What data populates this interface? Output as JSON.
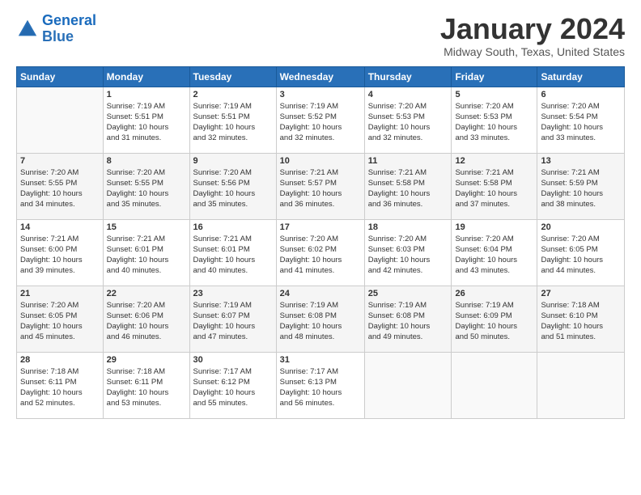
{
  "header": {
    "logo_line1": "General",
    "logo_line2": "Blue",
    "title": "January 2024",
    "subtitle": "Midway South, Texas, United States"
  },
  "days_of_week": [
    "Sunday",
    "Monday",
    "Tuesday",
    "Wednesday",
    "Thursday",
    "Friday",
    "Saturday"
  ],
  "weeks": [
    [
      {
        "day": "",
        "info": ""
      },
      {
        "day": "1",
        "info": "Sunrise: 7:19 AM\nSunset: 5:51 PM\nDaylight: 10 hours\nand 31 minutes."
      },
      {
        "day": "2",
        "info": "Sunrise: 7:19 AM\nSunset: 5:51 PM\nDaylight: 10 hours\nand 32 minutes."
      },
      {
        "day": "3",
        "info": "Sunrise: 7:19 AM\nSunset: 5:52 PM\nDaylight: 10 hours\nand 32 minutes."
      },
      {
        "day": "4",
        "info": "Sunrise: 7:20 AM\nSunset: 5:53 PM\nDaylight: 10 hours\nand 32 minutes."
      },
      {
        "day": "5",
        "info": "Sunrise: 7:20 AM\nSunset: 5:53 PM\nDaylight: 10 hours\nand 33 minutes."
      },
      {
        "day": "6",
        "info": "Sunrise: 7:20 AM\nSunset: 5:54 PM\nDaylight: 10 hours\nand 33 minutes."
      }
    ],
    [
      {
        "day": "7",
        "info": "Sunrise: 7:20 AM\nSunset: 5:55 PM\nDaylight: 10 hours\nand 34 minutes."
      },
      {
        "day": "8",
        "info": "Sunrise: 7:20 AM\nSunset: 5:55 PM\nDaylight: 10 hours\nand 35 minutes."
      },
      {
        "day": "9",
        "info": "Sunrise: 7:20 AM\nSunset: 5:56 PM\nDaylight: 10 hours\nand 35 minutes."
      },
      {
        "day": "10",
        "info": "Sunrise: 7:21 AM\nSunset: 5:57 PM\nDaylight: 10 hours\nand 36 minutes."
      },
      {
        "day": "11",
        "info": "Sunrise: 7:21 AM\nSunset: 5:58 PM\nDaylight: 10 hours\nand 36 minutes."
      },
      {
        "day": "12",
        "info": "Sunrise: 7:21 AM\nSunset: 5:58 PM\nDaylight: 10 hours\nand 37 minutes."
      },
      {
        "day": "13",
        "info": "Sunrise: 7:21 AM\nSunset: 5:59 PM\nDaylight: 10 hours\nand 38 minutes."
      }
    ],
    [
      {
        "day": "14",
        "info": "Sunrise: 7:21 AM\nSunset: 6:00 PM\nDaylight: 10 hours\nand 39 minutes."
      },
      {
        "day": "15",
        "info": "Sunrise: 7:21 AM\nSunset: 6:01 PM\nDaylight: 10 hours\nand 40 minutes."
      },
      {
        "day": "16",
        "info": "Sunrise: 7:21 AM\nSunset: 6:01 PM\nDaylight: 10 hours\nand 40 minutes."
      },
      {
        "day": "17",
        "info": "Sunrise: 7:20 AM\nSunset: 6:02 PM\nDaylight: 10 hours\nand 41 minutes."
      },
      {
        "day": "18",
        "info": "Sunrise: 7:20 AM\nSunset: 6:03 PM\nDaylight: 10 hours\nand 42 minutes."
      },
      {
        "day": "19",
        "info": "Sunrise: 7:20 AM\nSunset: 6:04 PM\nDaylight: 10 hours\nand 43 minutes."
      },
      {
        "day": "20",
        "info": "Sunrise: 7:20 AM\nSunset: 6:05 PM\nDaylight: 10 hours\nand 44 minutes."
      }
    ],
    [
      {
        "day": "21",
        "info": "Sunrise: 7:20 AM\nSunset: 6:05 PM\nDaylight: 10 hours\nand 45 minutes."
      },
      {
        "day": "22",
        "info": "Sunrise: 7:20 AM\nSunset: 6:06 PM\nDaylight: 10 hours\nand 46 minutes."
      },
      {
        "day": "23",
        "info": "Sunrise: 7:19 AM\nSunset: 6:07 PM\nDaylight: 10 hours\nand 47 minutes."
      },
      {
        "day": "24",
        "info": "Sunrise: 7:19 AM\nSunset: 6:08 PM\nDaylight: 10 hours\nand 48 minutes."
      },
      {
        "day": "25",
        "info": "Sunrise: 7:19 AM\nSunset: 6:08 PM\nDaylight: 10 hours\nand 49 minutes."
      },
      {
        "day": "26",
        "info": "Sunrise: 7:19 AM\nSunset: 6:09 PM\nDaylight: 10 hours\nand 50 minutes."
      },
      {
        "day": "27",
        "info": "Sunrise: 7:18 AM\nSunset: 6:10 PM\nDaylight: 10 hours\nand 51 minutes."
      }
    ],
    [
      {
        "day": "28",
        "info": "Sunrise: 7:18 AM\nSunset: 6:11 PM\nDaylight: 10 hours\nand 52 minutes."
      },
      {
        "day": "29",
        "info": "Sunrise: 7:18 AM\nSunset: 6:11 PM\nDaylight: 10 hours\nand 53 minutes."
      },
      {
        "day": "30",
        "info": "Sunrise: 7:17 AM\nSunset: 6:12 PM\nDaylight: 10 hours\nand 55 minutes."
      },
      {
        "day": "31",
        "info": "Sunrise: 7:17 AM\nSunset: 6:13 PM\nDaylight: 10 hours\nand 56 minutes."
      },
      {
        "day": "",
        "info": ""
      },
      {
        "day": "",
        "info": ""
      },
      {
        "day": "",
        "info": ""
      }
    ]
  ]
}
